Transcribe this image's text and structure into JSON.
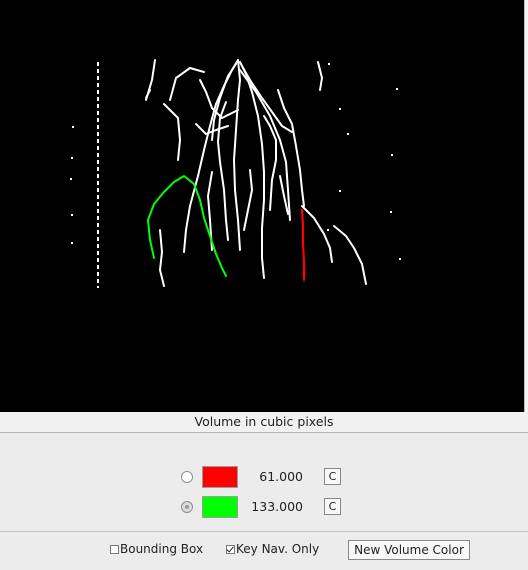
{
  "viewer": {
    "background": "#000000",
    "trace_color": "#ffffff",
    "volume_colors": [
      "#ff0000",
      "#00ff00"
    ]
  },
  "panel": {
    "title": "Volume in cubic pixels",
    "volumes": [
      {
        "color": "#ff0000",
        "value": "61.000",
        "selected": false,
        "clear_label": "C"
      },
      {
        "color": "#00ff00",
        "value": "133.000",
        "selected": true,
        "clear_label": "C"
      }
    ]
  },
  "options": {
    "bounding_box": {
      "label": "Bounding Box",
      "checked": false
    },
    "key_nav_only": {
      "label": "Key Nav. Only",
      "checked": true
    },
    "new_volume_color_label": "New Volume Color"
  }
}
